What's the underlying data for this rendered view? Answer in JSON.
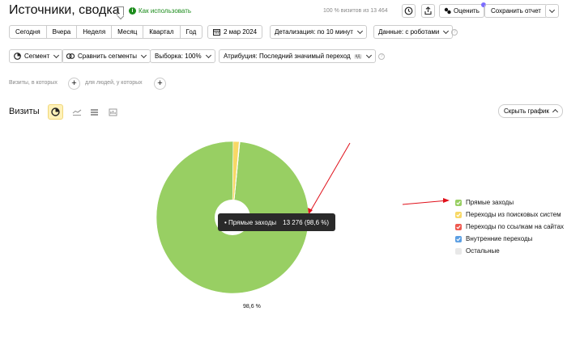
{
  "header": {
    "title": "Источники, сводка",
    "howto": "Как использовать",
    "visits_info": "100 % визитов из 13 464",
    "rate_label": "Оценить",
    "save_label": "Сохранить отчет"
  },
  "period": {
    "buttons": [
      "Сегодня",
      "Вчера",
      "Неделя",
      "Месяц",
      "Квартал",
      "Год"
    ],
    "date": "2 мар 2024",
    "detail": "Детализация: по 10 минут",
    "robots": "Данные: с роботами"
  },
  "controls": {
    "segment": "Сегмент",
    "compare": "Сравнить сегменты",
    "sample": "Выборка: 100%",
    "attribution": "Атрибуция: Последний значимый переход",
    "attribution_badge": "кд"
  },
  "filters": {
    "visits_label": "Визиты, в которых",
    "people_label": "для людей, у которых"
  },
  "chart_header": {
    "title": "Визиты",
    "hide_label": "Скрыть график"
  },
  "tooltip": {
    "label": "Прямые заходы",
    "value": "13 276 (98,6 %)"
  },
  "pie_label": "98,6 %",
  "colors": {
    "direct": "#98cf63",
    "search": "#f8d865",
    "links": "#ef5a50",
    "internal": "#5c9fe3",
    "other": "#e8e8e8",
    "arrow": "#e0101a"
  },
  "chart_data": {
    "type": "pie",
    "categories": [
      "Прямые заходы",
      "Переходы из поисковых систем",
      "Переходы по ссылкам на сайтах",
      "Внутренние переходы",
      "Остальные"
    ],
    "values": [
      13276,
      170,
      12,
      4,
      2
    ],
    "colors": [
      "#98cf63",
      "#f8d865",
      "#ef5a50",
      "#5c9fe3",
      "#e8e8e8"
    ],
    "checked": [
      true,
      true,
      true,
      true,
      false
    ],
    "donut": true,
    "legend_position": "right"
  }
}
